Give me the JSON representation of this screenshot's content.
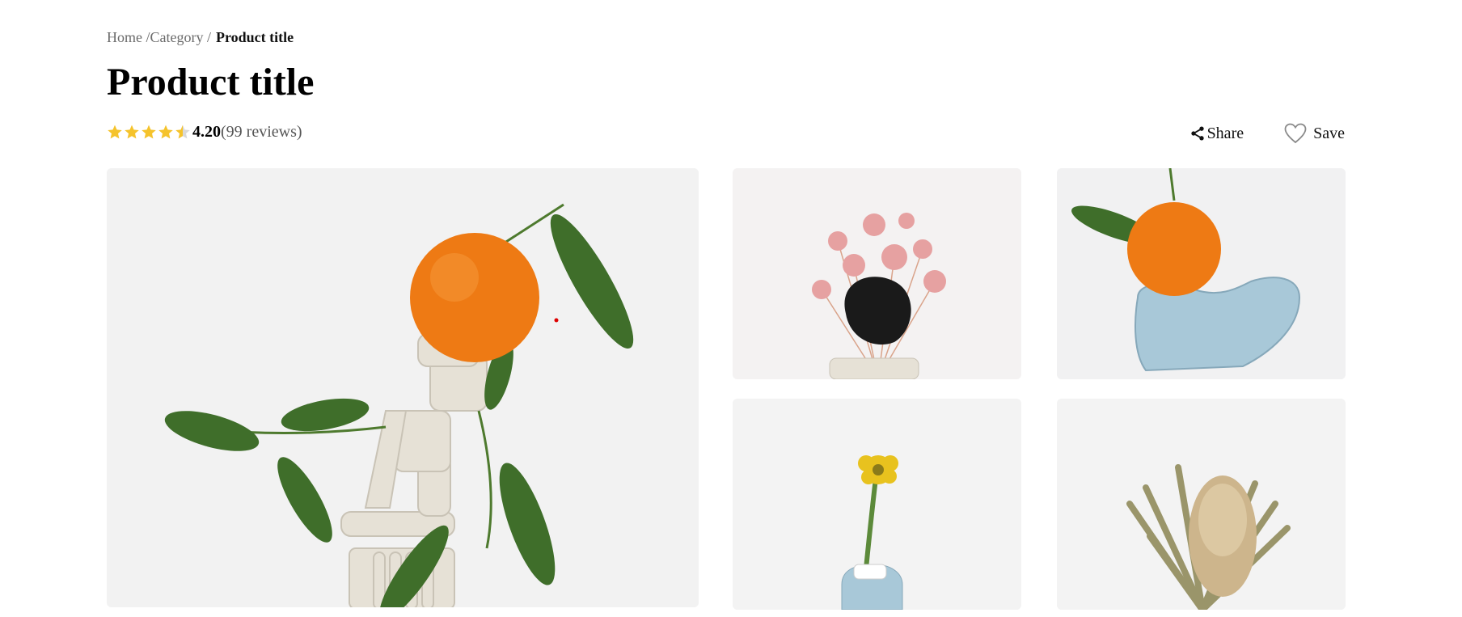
{
  "breadcrumb": {
    "home": "Home /",
    "category": "Category /",
    "current": "Product title"
  },
  "product": {
    "title": "Product title",
    "rating": {
      "value": "4.20",
      "reviews": "(99 reviews)",
      "stars_filled": 4.5,
      "stars_total": 5,
      "star_color": "#f5c32c"
    }
  },
  "actions": {
    "share_label": "Share",
    "save_label": "Save",
    "share_icon": "share-icon",
    "save_icon": "heart-icon"
  },
  "gallery": {
    "main": "orange-on-clay-sculpture",
    "thumbnails": [
      "pink-dried-flowers-with-black-stone",
      "orange-on-blue-clay-vase",
      "yellow-flower-in-blue-vase",
      "dried-banksia-bouquet"
    ]
  }
}
